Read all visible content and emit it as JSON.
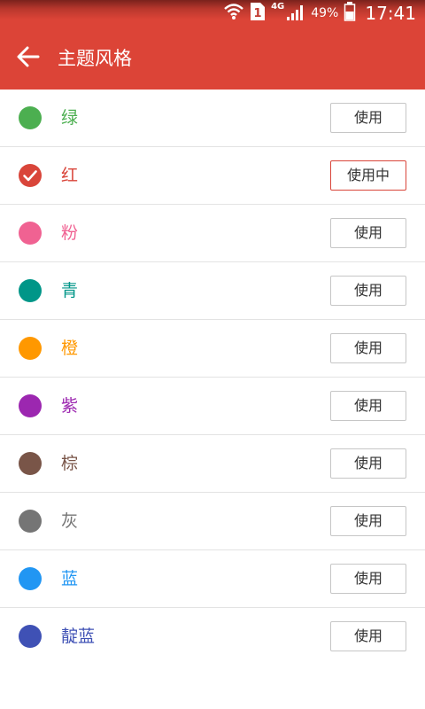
{
  "status_bar": {
    "network": "4G",
    "battery_percent": "49%",
    "time": "17:41",
    "sim_label": "1",
    "icons": [
      "wifi-icon",
      "sim-icon",
      "signal-icon",
      "battery-icon"
    ]
  },
  "toolbar": {
    "title": "主题风格",
    "back_icon": "arrow-left-icon",
    "background_color": "#dc4437"
  },
  "themes": [
    {
      "name": "绿",
      "color": "#4caf50",
      "button_label": "使用",
      "selected": false
    },
    {
      "name": "红",
      "color": "#d9453a",
      "button_label": "使用中",
      "selected": true
    },
    {
      "name": "粉",
      "color": "#f06292",
      "button_label": "使用",
      "selected": false
    },
    {
      "name": "青",
      "color": "#009688",
      "button_label": "使用",
      "selected": false
    },
    {
      "name": "橙",
      "color": "#ff9800",
      "button_label": "使用",
      "selected": false
    },
    {
      "name": "紫",
      "color": "#9c27b0",
      "button_label": "使用",
      "selected": false
    },
    {
      "name": "棕",
      "color": "#795548",
      "button_label": "使用",
      "selected": false
    },
    {
      "name": "灰",
      "color": "#757575",
      "button_label": "使用",
      "selected": false
    },
    {
      "name": "蓝",
      "color": "#2196f3",
      "button_label": "使用",
      "selected": false
    },
    {
      "name": "靛蓝",
      "color": "#3f51b5",
      "button_label": "使用",
      "selected": false
    }
  ]
}
